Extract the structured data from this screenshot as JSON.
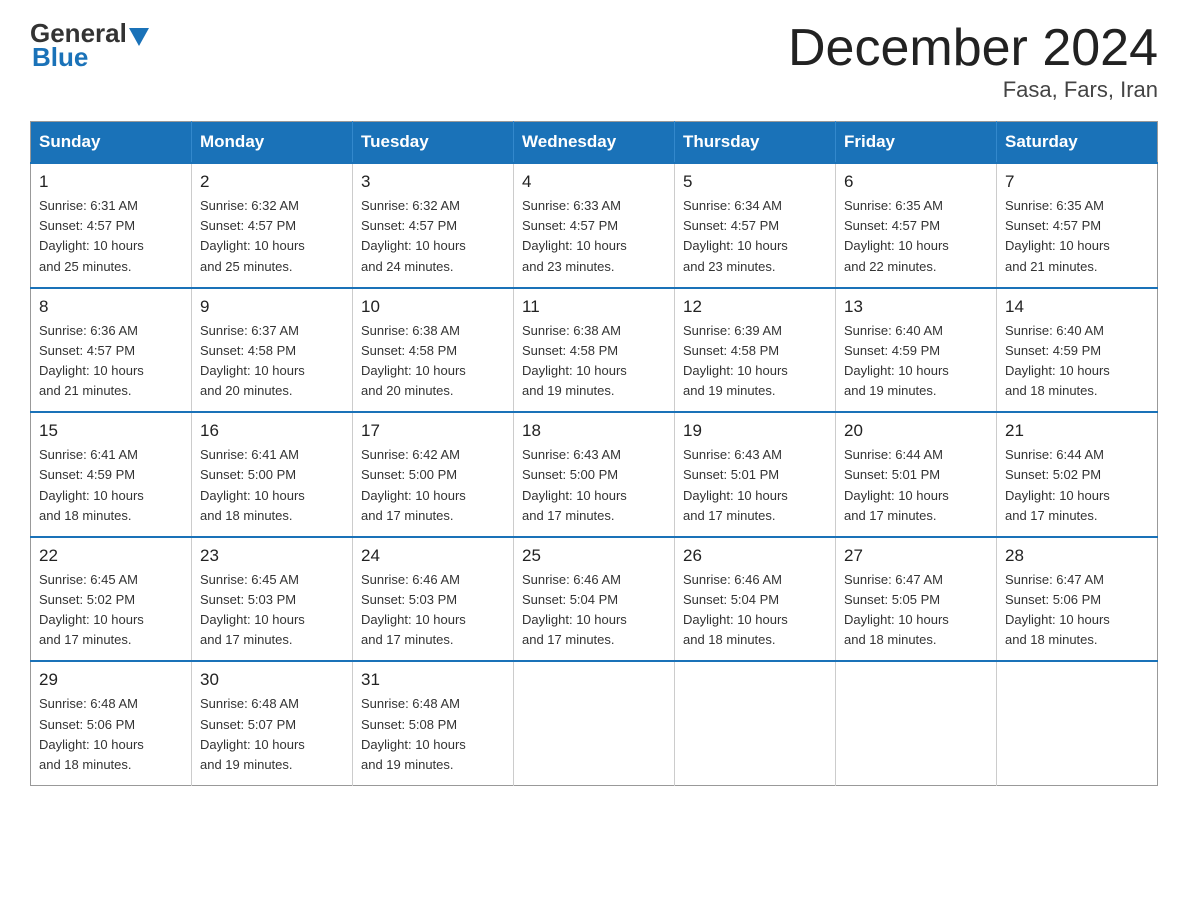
{
  "header": {
    "logo_general": "General",
    "logo_blue": "Blue",
    "month_title": "December 2024",
    "location": "Fasa, Fars, Iran"
  },
  "days_of_week": [
    "Sunday",
    "Monday",
    "Tuesday",
    "Wednesday",
    "Thursday",
    "Friday",
    "Saturday"
  ],
  "weeks": [
    [
      {
        "day": "1",
        "sunrise": "6:31 AM",
        "sunset": "4:57 PM",
        "daylight": "10 hours and 25 minutes."
      },
      {
        "day": "2",
        "sunrise": "6:32 AM",
        "sunset": "4:57 PM",
        "daylight": "10 hours and 25 minutes."
      },
      {
        "day": "3",
        "sunrise": "6:32 AM",
        "sunset": "4:57 PM",
        "daylight": "10 hours and 24 minutes."
      },
      {
        "day": "4",
        "sunrise": "6:33 AM",
        "sunset": "4:57 PM",
        "daylight": "10 hours and 23 minutes."
      },
      {
        "day": "5",
        "sunrise": "6:34 AM",
        "sunset": "4:57 PM",
        "daylight": "10 hours and 23 minutes."
      },
      {
        "day": "6",
        "sunrise": "6:35 AM",
        "sunset": "4:57 PM",
        "daylight": "10 hours and 22 minutes."
      },
      {
        "day": "7",
        "sunrise": "6:35 AM",
        "sunset": "4:57 PM",
        "daylight": "10 hours and 21 minutes."
      }
    ],
    [
      {
        "day": "8",
        "sunrise": "6:36 AM",
        "sunset": "4:57 PM",
        "daylight": "10 hours and 21 minutes."
      },
      {
        "day": "9",
        "sunrise": "6:37 AM",
        "sunset": "4:58 PM",
        "daylight": "10 hours and 20 minutes."
      },
      {
        "day": "10",
        "sunrise": "6:38 AM",
        "sunset": "4:58 PM",
        "daylight": "10 hours and 20 minutes."
      },
      {
        "day": "11",
        "sunrise": "6:38 AM",
        "sunset": "4:58 PM",
        "daylight": "10 hours and 19 minutes."
      },
      {
        "day": "12",
        "sunrise": "6:39 AM",
        "sunset": "4:58 PM",
        "daylight": "10 hours and 19 minutes."
      },
      {
        "day": "13",
        "sunrise": "6:40 AM",
        "sunset": "4:59 PM",
        "daylight": "10 hours and 19 minutes."
      },
      {
        "day": "14",
        "sunrise": "6:40 AM",
        "sunset": "4:59 PM",
        "daylight": "10 hours and 18 minutes."
      }
    ],
    [
      {
        "day": "15",
        "sunrise": "6:41 AM",
        "sunset": "4:59 PM",
        "daylight": "10 hours and 18 minutes."
      },
      {
        "day": "16",
        "sunrise": "6:41 AM",
        "sunset": "5:00 PM",
        "daylight": "10 hours and 18 minutes."
      },
      {
        "day": "17",
        "sunrise": "6:42 AM",
        "sunset": "5:00 PM",
        "daylight": "10 hours and 17 minutes."
      },
      {
        "day": "18",
        "sunrise": "6:43 AM",
        "sunset": "5:00 PM",
        "daylight": "10 hours and 17 minutes."
      },
      {
        "day": "19",
        "sunrise": "6:43 AM",
        "sunset": "5:01 PM",
        "daylight": "10 hours and 17 minutes."
      },
      {
        "day": "20",
        "sunrise": "6:44 AM",
        "sunset": "5:01 PM",
        "daylight": "10 hours and 17 minutes."
      },
      {
        "day": "21",
        "sunrise": "6:44 AM",
        "sunset": "5:02 PM",
        "daylight": "10 hours and 17 minutes."
      }
    ],
    [
      {
        "day": "22",
        "sunrise": "6:45 AM",
        "sunset": "5:02 PM",
        "daylight": "10 hours and 17 minutes."
      },
      {
        "day": "23",
        "sunrise": "6:45 AM",
        "sunset": "5:03 PM",
        "daylight": "10 hours and 17 minutes."
      },
      {
        "day": "24",
        "sunrise": "6:46 AM",
        "sunset": "5:03 PM",
        "daylight": "10 hours and 17 minutes."
      },
      {
        "day": "25",
        "sunrise": "6:46 AM",
        "sunset": "5:04 PM",
        "daylight": "10 hours and 17 minutes."
      },
      {
        "day": "26",
        "sunrise": "6:46 AM",
        "sunset": "5:04 PM",
        "daylight": "10 hours and 18 minutes."
      },
      {
        "day": "27",
        "sunrise": "6:47 AM",
        "sunset": "5:05 PM",
        "daylight": "10 hours and 18 minutes."
      },
      {
        "day": "28",
        "sunrise": "6:47 AM",
        "sunset": "5:06 PM",
        "daylight": "10 hours and 18 minutes."
      }
    ],
    [
      {
        "day": "29",
        "sunrise": "6:48 AM",
        "sunset": "5:06 PM",
        "daylight": "10 hours and 18 minutes."
      },
      {
        "day": "30",
        "sunrise": "6:48 AM",
        "sunset": "5:07 PM",
        "daylight": "10 hours and 19 minutes."
      },
      {
        "day": "31",
        "sunrise": "6:48 AM",
        "sunset": "5:08 PM",
        "daylight": "10 hours and 19 minutes."
      },
      null,
      null,
      null,
      null
    ]
  ],
  "labels": {
    "sunrise": "Sunrise:",
    "sunset": "Sunset:",
    "daylight": "Daylight:"
  }
}
